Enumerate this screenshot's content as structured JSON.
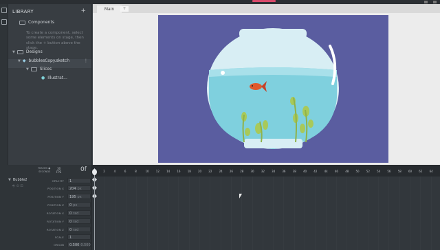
{
  "library": {
    "title": "LIBRARY",
    "add_label": "+",
    "components_label": "Components",
    "components_help": "To create a component, select some elements on stage, then click the + button above the stage.",
    "designs_label": "Designs",
    "file_label": "bubblesCopy.sketch",
    "file_menu": "⋮",
    "slices_label": "Slices",
    "asset_label": "Illustrat..."
  },
  "stage": {
    "tab_main": "Main",
    "tab_add": "+"
  },
  "timeline": {
    "frames_label": "FRAMES",
    "seconds_label": "SECONDS",
    "fps_value": "30",
    "fps_label": "FPS",
    "current_frame": "0f",
    "ticks": [
      "0",
      "2",
      "4",
      "6",
      "8",
      "10",
      "12",
      "14",
      "16",
      "18",
      "20",
      "22",
      "24",
      "26",
      "28",
      "30",
      "32",
      "34",
      "36",
      "38",
      "40",
      "42",
      "44",
      "46",
      "48",
      "50",
      "52",
      "54",
      "56",
      "58",
      "60",
      "62",
      "64"
    ],
    "layer_name": "Bubble2",
    "properties": [
      {
        "label": "OPACITY",
        "value": "1",
        "unit": ""
      },
      {
        "label": "POSITION X",
        "value": "204",
        "unit": "px"
      },
      {
        "label": "POSITION Y",
        "value": "195",
        "unit": "px"
      },
      {
        "label": "POSITION Z",
        "value": "0",
        "unit": "px"
      },
      {
        "label": "ROTATION X",
        "value": "0",
        "unit": "rad"
      },
      {
        "label": "ROTATION Y",
        "value": "0",
        "unit": "rad"
      },
      {
        "label": "ROTATION Z",
        "value": "0",
        "unit": "rad"
      },
      {
        "label": "SCALE",
        "value": "1",
        "unit": ""
      },
      {
        "label": "ORIGIN",
        "value": "0.500",
        "unit": "0.500"
      }
    ]
  },
  "colors": {
    "accent": "#d94a6a",
    "stage_bg": "#5a5da0"
  }
}
